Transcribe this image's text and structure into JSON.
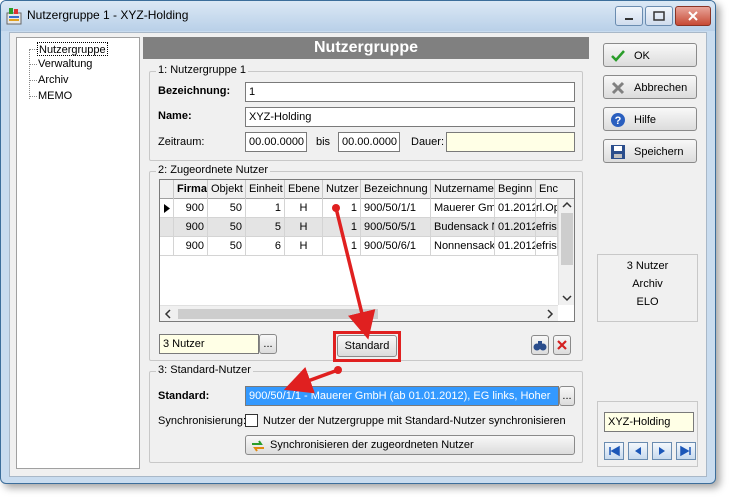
{
  "window": {
    "title": "Nutzergruppe 1 - XYZ-Holding"
  },
  "tree": {
    "items": [
      "Nutzergruppe",
      "Verwaltung",
      "Archiv",
      "MEMO"
    ]
  },
  "panel": {
    "header": "Nutzergruppe"
  },
  "section1": {
    "title": "1: Nutzergruppe 1",
    "bezeichnung_label": "Bezeichnung:",
    "bezeichnung_value": "1",
    "name_label": "Name:",
    "name_value": "XYZ-Holding",
    "zeitraum_label": "Zeitraum:",
    "from_value": "00.00.0000",
    "bis_label": "bis",
    "to_value": "00.00.0000",
    "dauer_label": "Dauer:",
    "dauer_value": ""
  },
  "section2": {
    "title": "2: Zugeordnete Nutzer",
    "columns": [
      "Firma",
      "Objekt",
      "Einheit",
      "Ebene",
      "Nutzer",
      "Bezeichnung",
      "Nutzername",
      "Beginn",
      "Enc"
    ],
    "rows": [
      [
        "900",
        "50",
        "1",
        "H",
        "1",
        "900/50/1/1",
        "Mauerer Gml",
        "01.2012",
        "rl.Op"
      ],
      [
        "900",
        "50",
        "5",
        "H",
        "1",
        "900/50/5/1",
        "Budensack N",
        "01.2012",
        "efriste"
      ],
      [
        "900",
        "50",
        "6",
        "H",
        "1",
        "900/50/6/1",
        "Nonnensack",
        "01.2012",
        "efriste"
      ]
    ],
    "nutzer_combo": "3 Nutzer",
    "combo_btn": "...",
    "standard_button": "Standard"
  },
  "section3": {
    "title": "3: Standard-Nutzer",
    "standard_label": "Standard:",
    "standard_value": "900/50/1/1 - Mauerer GmbH  (ab 01.01.2012), EG links, Hoher",
    "browse_btn": "...",
    "sync_label": "Synchronisierung:",
    "sync_checkbox_label": "Nutzer der Nutzergruppe mit Standard-Nutzer synchronisieren",
    "sync_button": "Synchronisieren der zugeordneten Nutzer"
  },
  "actions": {
    "ok": "OK",
    "cancel": "Abbrechen",
    "help": "Hilfe",
    "save": "Speichern"
  },
  "info": {
    "line1": "3 Nutzer",
    "line2": "Archiv",
    "line3": "ELO"
  },
  "navigator": {
    "value": "XYZ-Holding"
  }
}
